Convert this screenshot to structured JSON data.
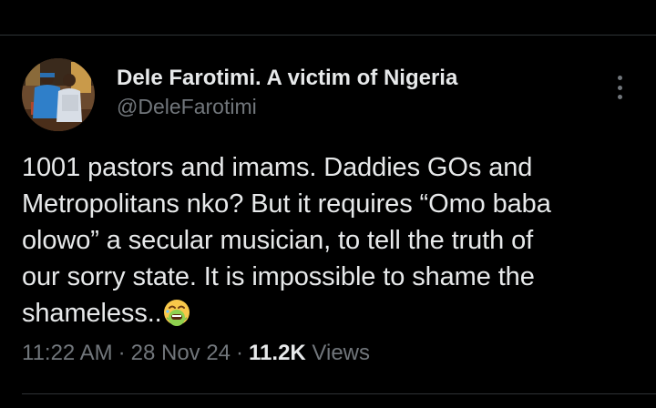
{
  "tweet": {
    "author_name": "Dele Farotimi. A victim of Nigeria",
    "author_handle": "@DeleFarotimi",
    "text_lines": [
      "1001 pastors and imams. Daddies GOs and",
      "Metropolitans nko? But it requires “Omo baba",
      "olowo” a secular musician, to tell the truth of",
      "our sorry state. It is impossible to shame the",
      "shameless.."
    ],
    "trailing_emoji": "nauseated-face-emoji",
    "time": "11:22 AM",
    "date": "28 Nov 24",
    "separator": "·",
    "views_count": "11.2K",
    "views_label": "Views"
  },
  "icons": {
    "more": "more-vertical-icon",
    "emoji": "nauseated-face-emoji"
  },
  "colors": {
    "background": "#000000",
    "primary_text": "#e7e9ea",
    "secondary_text": "#71767b",
    "divider": "#2f3336"
  }
}
